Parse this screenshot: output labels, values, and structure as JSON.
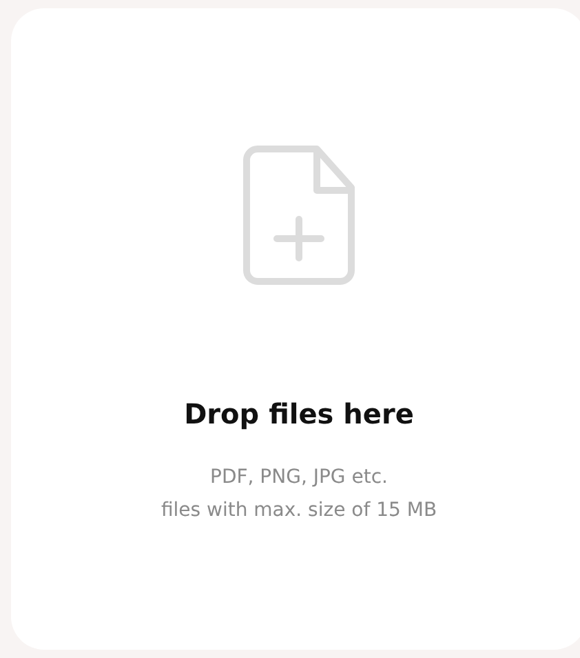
{
  "dropzone": {
    "title": "Drop files here",
    "hint_lines": [
      "PDF, PNG, JPG etc.",
      "files with max. size of 15 MB"
    ]
  }
}
